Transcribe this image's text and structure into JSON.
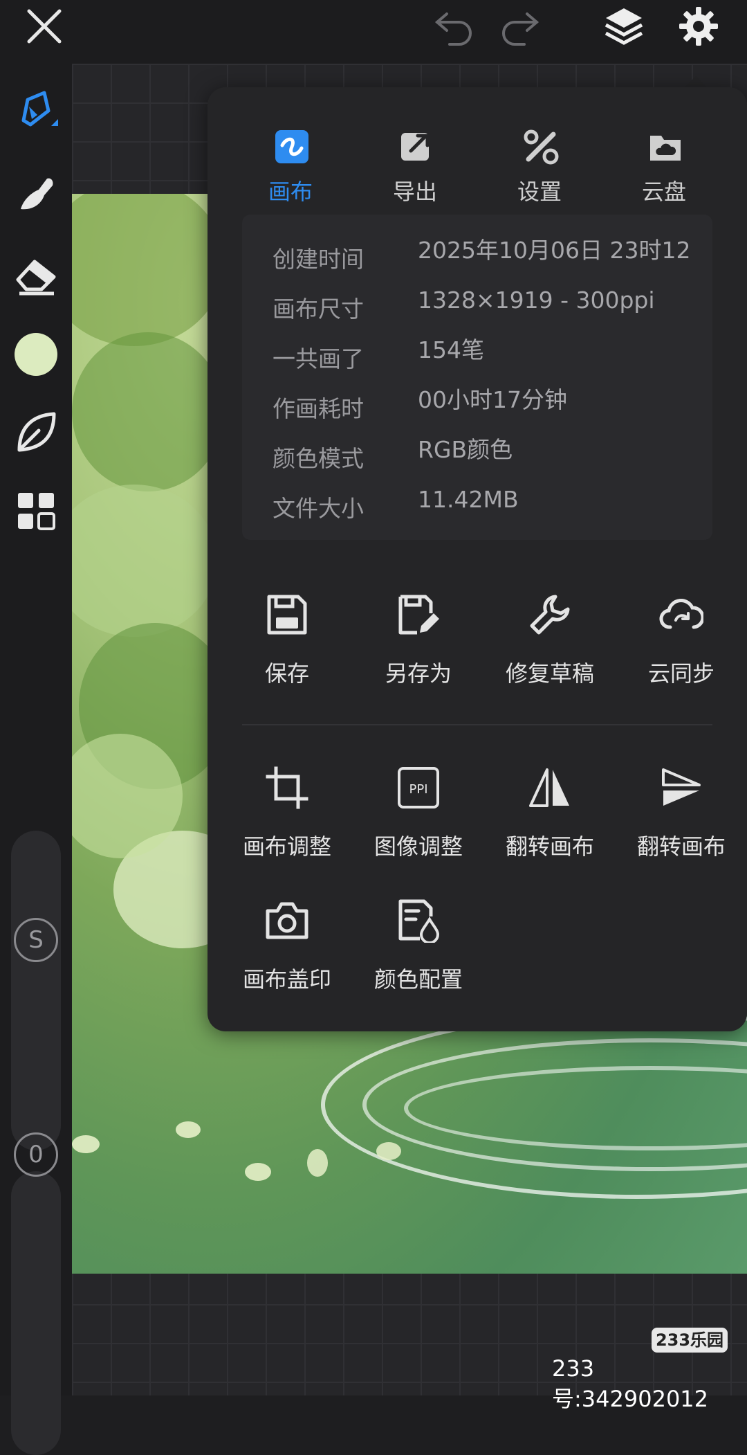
{
  "panel": {
    "tabs": [
      {
        "label": "画布",
        "icon": "canvas-icon",
        "active": true
      },
      {
        "label": "导出",
        "icon": "export-icon",
        "active": false
      },
      {
        "label": "设置",
        "icon": "settings-tools-icon",
        "active": false
      },
      {
        "label": "云盘",
        "icon": "cloud-drive-icon",
        "active": false
      }
    ],
    "info": [
      {
        "label": "创建时间",
        "value": "2025年10月06日 23时12分"
      },
      {
        "label": "画布尺寸",
        "value": "1328×1919 - 300ppi"
      },
      {
        "label": "一共画了",
        "value": "154笔"
      },
      {
        "label": "作画耗时",
        "value": "00小时17分钟"
      },
      {
        "label": "颜色模式",
        "value": "RGB颜色"
      },
      {
        "label": "文件大小",
        "value": "11.42MB"
      }
    ],
    "actions": [
      {
        "label": "保存",
        "icon": "save-icon"
      },
      {
        "label": "另存为",
        "icon": "save-as-icon"
      },
      {
        "label": "修复草稿",
        "icon": "wrench-icon"
      },
      {
        "label": "云同步",
        "icon": "cloud-sync-icon"
      }
    ],
    "tools": [
      {
        "label": "画布调整",
        "icon": "crop-icon"
      },
      {
        "label": "图像调整",
        "icon": "ppi-icon"
      },
      {
        "label": "翻转画布",
        "icon": "flip-horizontal-icon"
      },
      {
        "label": "翻转画布",
        "icon": "flip-vertical-icon"
      },
      {
        "label": "画布盖印",
        "icon": "camera-icon"
      },
      {
        "label": "颜色配置",
        "icon": "color-profile-icon"
      }
    ]
  },
  "leftbar": {
    "size_button": "S",
    "opacity_button": "0",
    "current_color": "#dcebbf"
  },
  "colors": {
    "accent": "#2e8cf0",
    "panel_bg": "#252527"
  },
  "watermark": {
    "logo": "233乐园",
    "id": "233号:342902012"
  }
}
